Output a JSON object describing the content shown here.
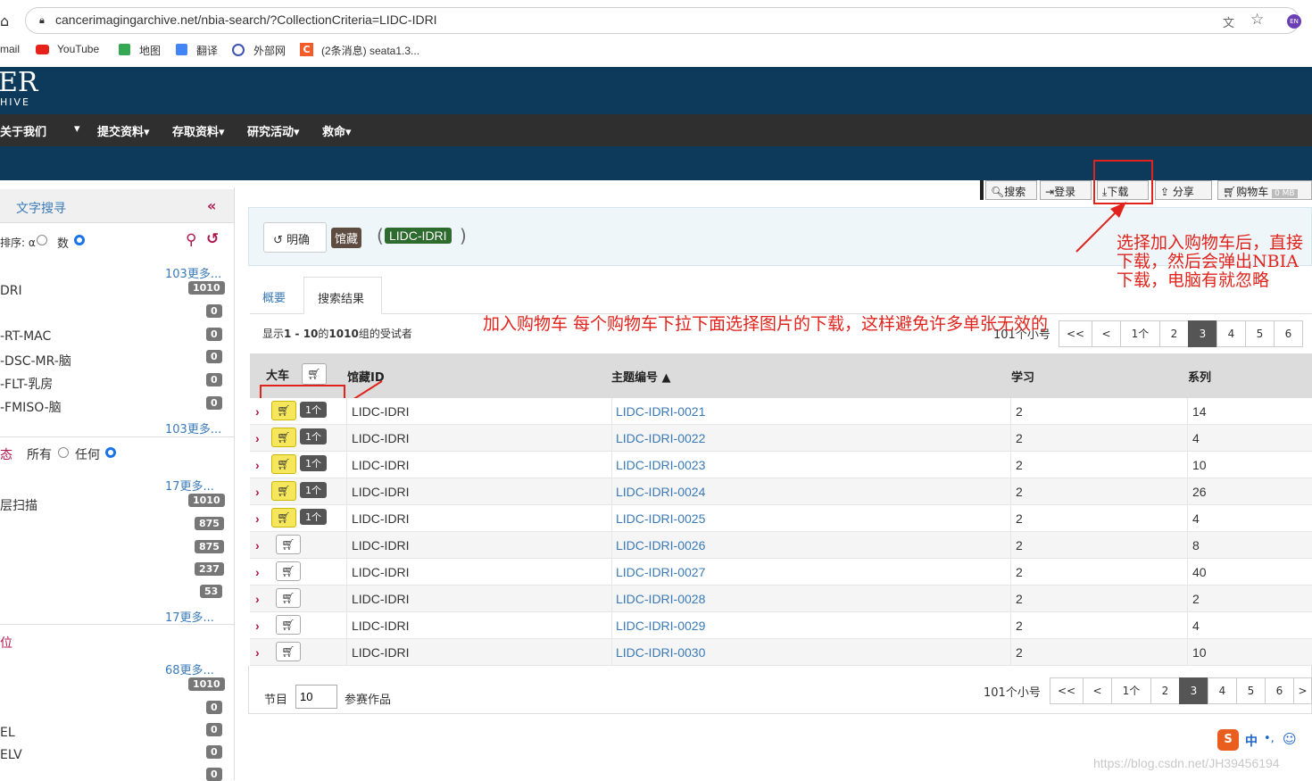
{
  "browser": {
    "url": "cancerimagingarchive.net/nbia-search/?CollectionCriteria=LIDC-IDRI",
    "bookmarks": [
      "mail",
      "YouTube",
      "地图",
      "翻译",
      "外部网",
      "(2条消息) seata1.3..."
    ],
    "avatar": "EN"
  },
  "site": {
    "logo_top": "ER",
    "logo_bottom": "HIVE",
    "nav": [
      "关于我们",
      "提交资料▾",
      "存取资料▾",
      "研究活动▾",
      "救命▾"
    ]
  },
  "toolbar": {
    "search": "搜索",
    "login": "登录",
    "download": "下载",
    "share": "分享",
    "cart": "购物车",
    "cart_size": "0 MB"
  },
  "sidebar": {
    "title": "文字搜寻",
    "sort_label": "排序: α",
    "sort_num": "数",
    "collections_more": "103更多...",
    "collections": [
      {
        "label": "DRI",
        "count": "1010"
      },
      {
        "label": "",
        "count": "0"
      },
      {
        "label": "-RT-MAC",
        "count": "0"
      },
      {
        "label": "-DSC-MR-脑",
        "count": "0"
      },
      {
        "label": "-FLT-乳房",
        "count": "0"
      },
      {
        "label": "-FMISO-脑",
        "count": "0"
      }
    ],
    "collections_more2": "103更多...",
    "modality_label": "态",
    "modality_all": "所有",
    "modality_any": "任何",
    "modality_more": "17更多...",
    "modalities": [
      {
        "label": "层扫描",
        "count": "1010"
      },
      {
        "label": "",
        "count": "875"
      },
      {
        "label": "",
        "count": "875"
      },
      {
        "label": "",
        "count": "237"
      },
      {
        "label": "",
        "count": "53"
      }
    ],
    "modality_more2": "17更多...",
    "body_label": "位",
    "body_more": "68更多...",
    "bodies": [
      {
        "label": "",
        "count": "1010"
      },
      {
        "label": "",
        "count": "0"
      },
      {
        "label": "EL",
        "count": "0"
      },
      {
        "label": "ELV",
        "count": "0"
      },
      {
        "label": "",
        "count": "0"
      }
    ]
  },
  "criteria": {
    "clear": "明确",
    "tag": "馆藏",
    "value": "LIDC-IDRI",
    "paren_open": "(",
    "paren_close": ")"
  },
  "tabs": [
    "概要",
    "搜索结果"
  ],
  "results": {
    "summary_prefix": "显示",
    "summary_range": "1 - 10",
    "summary_mid": "的",
    "summary_total": "1010",
    "summary_suffix": "组的受试者",
    "pages_label": "101个小号",
    "pages": [
      "<<",
      "<",
      "1个",
      "2",
      "3",
      "4",
      "5",
      "6",
      ">"
    ],
    "active_page": "3",
    "columns": {
      "cart": "大车",
      "collection": "馆藏ID",
      "subject": "主题编号 ▲",
      "study": "学习",
      "series": "系列"
    },
    "rows": [
      {
        "collection": "LIDC-IDRI",
        "subject": "LIDC-IDRI-0021",
        "study": "2",
        "series": "14",
        "in_cart": true,
        "cart_count": "1个"
      },
      {
        "collection": "LIDC-IDRI",
        "subject": "LIDC-IDRI-0022",
        "study": "2",
        "series": "4",
        "in_cart": true,
        "cart_count": "1个"
      },
      {
        "collection": "LIDC-IDRI",
        "subject": "LIDC-IDRI-0023",
        "study": "2",
        "series": "10",
        "in_cart": true,
        "cart_count": "1个"
      },
      {
        "collection": "LIDC-IDRI",
        "subject": "LIDC-IDRI-0024",
        "study": "2",
        "series": "26",
        "in_cart": true,
        "cart_count": "1个"
      },
      {
        "collection": "LIDC-IDRI",
        "subject": "LIDC-IDRI-0025",
        "study": "2",
        "series": "4",
        "in_cart": true,
        "cart_count": "1个"
      },
      {
        "collection": "LIDC-IDRI",
        "subject": "LIDC-IDRI-0026",
        "study": "2",
        "series": "8",
        "in_cart": false,
        "cart_count": ""
      },
      {
        "collection": "LIDC-IDRI",
        "subject": "LIDC-IDRI-0027",
        "study": "2",
        "series": "40",
        "in_cart": false,
        "cart_count": ""
      },
      {
        "collection": "LIDC-IDRI",
        "subject": "LIDC-IDRI-0028",
        "study": "2",
        "series": "2",
        "in_cart": false,
        "cart_count": ""
      },
      {
        "collection": "LIDC-IDRI",
        "subject": "LIDC-IDRI-0029",
        "study": "2",
        "series": "4",
        "in_cart": false,
        "cart_count": ""
      },
      {
        "collection": "LIDC-IDRI",
        "subject": "LIDC-IDRI-0030",
        "study": "2",
        "series": "10",
        "in_cart": false,
        "cart_count": ""
      }
    ],
    "per_page_label": "节目",
    "per_page_value": "10",
    "per_page_suffix": "参赛作品"
  },
  "annotations": {
    "right": "选择加入购物车后，直接下载，然后会弹出NBIA下载，电脑有就忽略",
    "middle": "加入购物车 每个购物车下拉下面选择图片的下载，这样避免许多单张无效的"
  },
  "ime": "中",
  "watermark": "https://blog.csdn.net/JH39456194",
  "colors": {
    "header": "#0d3a5b",
    "nav": "#2f2f2f",
    "annotation": "#e0231c",
    "link": "#3a7ab8",
    "cart_yellow": "#f5e65b"
  }
}
